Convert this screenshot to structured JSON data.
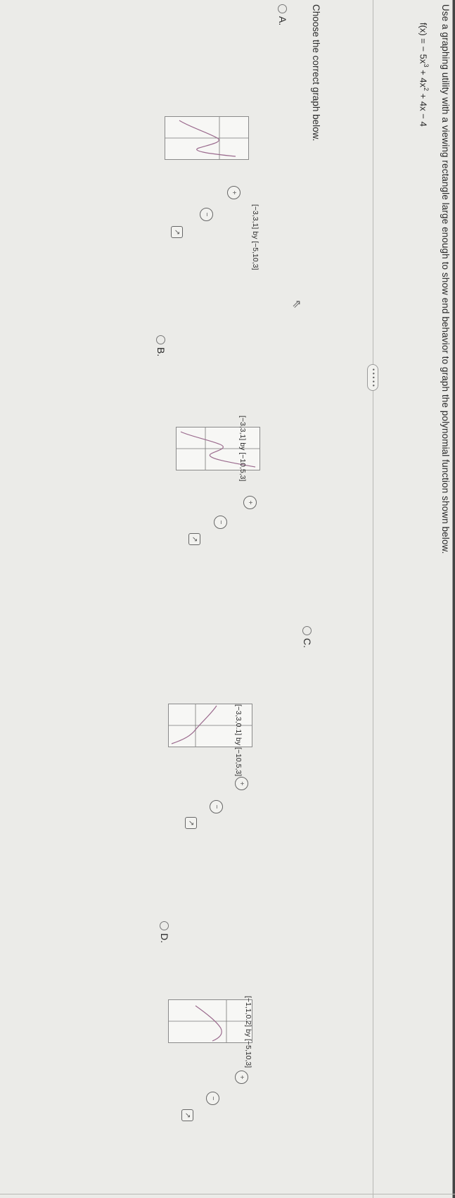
{
  "question": {
    "text": "Use a graphing utility with a viewing rectangle large enough to show end behavior to graph the polynomial function shown below.",
    "function_prefix": "f(x) = − 5x",
    "function_exp1": "3",
    "function_mid": " + 4x",
    "function_exp2": "2",
    "function_suffix": " + 4x − 4"
  },
  "instruction": "Choose the correct graph below.",
  "more_label": "• • • • •",
  "options": [
    {
      "letter": "A.",
      "window": "[−3,3,1] by [−5,10,3]",
      "zoom_in_icon": "zoom-in-icon",
      "zoom_out_icon": "zoom-out-icon",
      "popout_icon": "popout-icon"
    },
    {
      "letter": "B.",
      "window": "[−3,3,1] by [−10,5,3]",
      "zoom_in_icon": "zoom-in-icon",
      "zoom_out_icon": "zoom-out-icon",
      "popout_icon": "popout-icon"
    },
    {
      "letter": "C.",
      "window": "[−3,3,0.1] by [−10,5,3]",
      "zoom_in_icon": "zoom-in-icon",
      "zoom_out_icon": "zoom-out-icon",
      "popout_icon": "popout-icon"
    },
    {
      "letter": "D.",
      "window": "[−1,1,0.2] by [−5,10,3]",
      "zoom_in_icon": "zoom-in-icon",
      "zoom_out_icon": "zoom-out-icon",
      "popout_icon": "popout-icon"
    }
  ],
  "colors": {
    "curve": "#9b6b8e",
    "axis": "#666666",
    "frame": "#8a8a8a"
  }
}
